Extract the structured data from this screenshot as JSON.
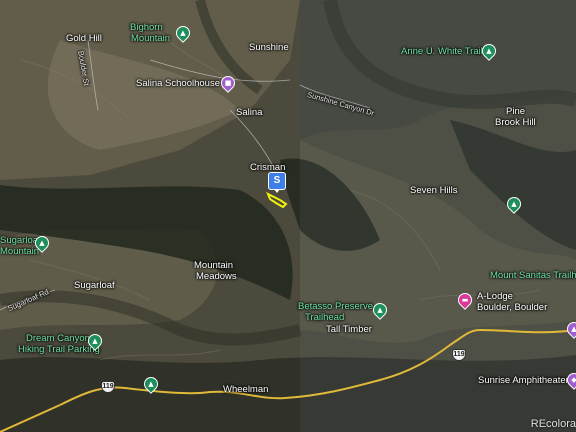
{
  "map": {
    "type": "satellite",
    "attribution": "REcolora",
    "listing_marker": "S"
  },
  "places": {
    "gold_hill": "Gold Hill",
    "bighorn_mountain_1": "Bighorn",
    "bighorn_mountain_2": "Mountain",
    "sunshine": "Sunshine",
    "salina_schoolhouse": "Salina Schoolhouse",
    "salina": "Salina",
    "anne_white_trail": "Anne U. White Trail",
    "pine_brook_hill_1": "Pine",
    "pine_brook_hill_2": "Brook Hill",
    "crisman": "Crisman",
    "seven_hills": "Seven Hills",
    "sugarloaf_mountain_1": "Sugarloaf",
    "sugarloaf_mountain_2": "Mountain",
    "mountain_meadows_1": "Mountain",
    "mountain_meadows_2": "Meadows",
    "mount_sanitas": "Mount Sanitas Trailhe",
    "sugarloaf": "Sugarloaf",
    "betasso_1": "Betasso Preserve",
    "betasso_2": "Trailhead",
    "a_lodge_1": "A-Lodge",
    "a_lodge_2": "Boulder, Boulder",
    "tall_timber": "Tall Timber",
    "dream_canyon_1": "Dream Canyon",
    "dream_canyon_2": "Hiking Trail Parking",
    "wheelman": "Wheelman",
    "sunrise_amphitheater": "Sunrise Amphitheater"
  },
  "roads": {
    "boulder_st": "Boulder St",
    "sunshine_canyon_dr": "Sunshine Canyon Dr",
    "sugarloaf_rd": "Sugarloaf Rd",
    "route_119": "119"
  },
  "icons": {
    "park": "tree-pin-icon",
    "school": "school-pin-icon",
    "lodge": "lodging-pin-icon",
    "theater": "theater-pin-icon"
  },
  "colors": {
    "park_pin": "#1e8e5a",
    "school_pin": "#a05fcf",
    "lodge_pin": "#d8399a",
    "label_green": "#6fe2a5",
    "highway": "#e0b93a",
    "marker": "#3d7ee8",
    "property_outline": "#f2f20a"
  }
}
